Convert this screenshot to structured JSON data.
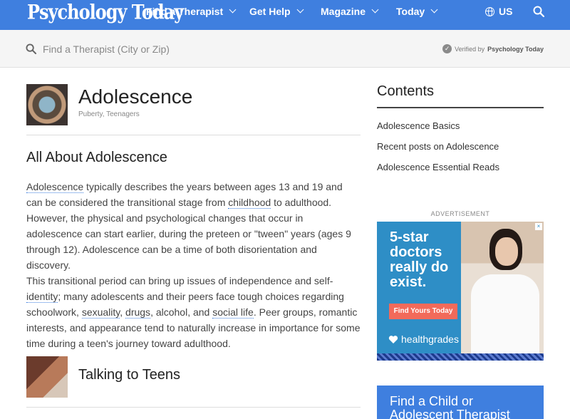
{
  "nav": {
    "logo": "Psychology Today",
    "items": [
      {
        "label": "Find a Therapist"
      },
      {
        "label": "Get Help"
      },
      {
        "label": "Magazine"
      },
      {
        "label": "Today"
      }
    ],
    "region": "US"
  },
  "searchbar": {
    "placeholder": "Find a Therapist (City or Zip)",
    "verified_prefix": "Verified by",
    "verified_brand": "Psychology Today"
  },
  "main": {
    "title": "Adolescence",
    "subtitle": "Puberty, Teenagers",
    "section_heading": "All About Adolescence",
    "paragraph1": {
      "link_adolescence": "Adolescence",
      "p1_a": " typically describes the years between ages 13 and 19 and can be considered the transitional stage from ",
      "link_childhood": "childhood",
      "p1_b": " to adulthood. However, the physical and psychological changes that occur in adolescence can start earlier, during the preteen or \"tween\" years (ages 9 through 12). Adolescence can be a time of both disorientation and discovery."
    },
    "paragraph2": {
      "p2_a": "This transitional period can bring up issues of independence and self-",
      "link_identity": "identity",
      "p2_b": "; many adolescents and their peers face tough choices regarding schoolwork, ",
      "link_sexuality": "sexuality",
      "sep1": ", ",
      "link_drugs": "drugs",
      "p2_c": ", alcohol, and ",
      "link_social": "social life",
      "p2_d": ". Peer groups, romantic interests, and appearance tend to naturally increase in importance for some time during a teen's journey toward adulthood."
    },
    "talking_heading": "Talking to Teens"
  },
  "sidebar": {
    "contents_heading": "Contents",
    "toc": [
      {
        "label": "Adolescence Basics"
      },
      {
        "label": "Recent posts on Adolescence"
      },
      {
        "label": "Adolescence Essential Reads"
      }
    ],
    "ad_label": "ADVERTISEMENT",
    "ad": {
      "headline": "5-star doctors really do exist.",
      "button": "Find Yours Today",
      "brand": "healthgrades"
    },
    "cta": "Find a Child or Adolescent Therapist"
  },
  "colors": {
    "brand_blue": "#3f7fdf",
    "ad_blue": "#2e8ec6",
    "ad_button": "#f26a5a"
  }
}
